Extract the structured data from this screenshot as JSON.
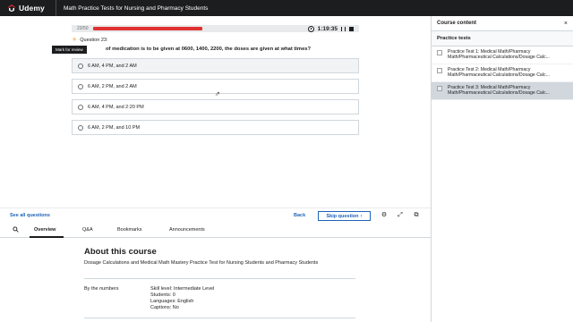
{
  "topbar": {
    "logo": "Udemy",
    "course_title": "Math Practice Tests for Nursing and Pharmacy Students"
  },
  "quiz": {
    "progress_count": "23/50",
    "progress_fraction": 0.44,
    "timer": "1:19:35",
    "question_number": "Question 23:",
    "tooltip": "Mark for review",
    "question_text": "of medication is to be given at 0600, 1400, 2200, the doses are given at what times?",
    "options": [
      "6 AM, 4 PM, and 2 AM",
      "6 AM, 2 PM, and 2 AM",
      "6 AM, 4 PM, and 2:20 PM",
      "6 AM, 2 PM, and 10 PM"
    ]
  },
  "actions": {
    "see_all": "See all questions",
    "back": "Back",
    "skip": "Skip question"
  },
  "tabs": [
    "Overview",
    "Q&A",
    "Bookmarks",
    "Announcements"
  ],
  "about": {
    "title": "About this course",
    "description": "Dosage Calculations and Medical Math Mastery Practice Test for Nursing Students and Pharmacy Students",
    "numbers_label": "By the numbers",
    "skill_level": "Skill level: Intermediate Level",
    "students": "Students: 0",
    "languages": "Languages: English",
    "captions": "Captions: No"
  },
  "sidebar": {
    "title": "Course content",
    "close": "×",
    "section": "Practice tests",
    "items": [
      {
        "line1": "Practice Test 1: Medical Math/Pharmacy",
        "line2": "Math/Pharmaceutical Calculations/Dosage Calc..."
      },
      {
        "line1": "Practice Test 2: Medical Math/Pharmacy",
        "line2": "Math/Pharmaceutical Calculations/Dosage Calc..."
      },
      {
        "line1": "Practice Test 3: Medical Math/Pharmacy",
        "line2": "Math/Pharmaceutical Calculations/Dosage Calc..."
      }
    ]
  },
  "colors": {
    "accent": "#1e63b8",
    "progress": "#e03131",
    "topbar": "#1c1d1f",
    "logo_mark": "#a435f0"
  }
}
